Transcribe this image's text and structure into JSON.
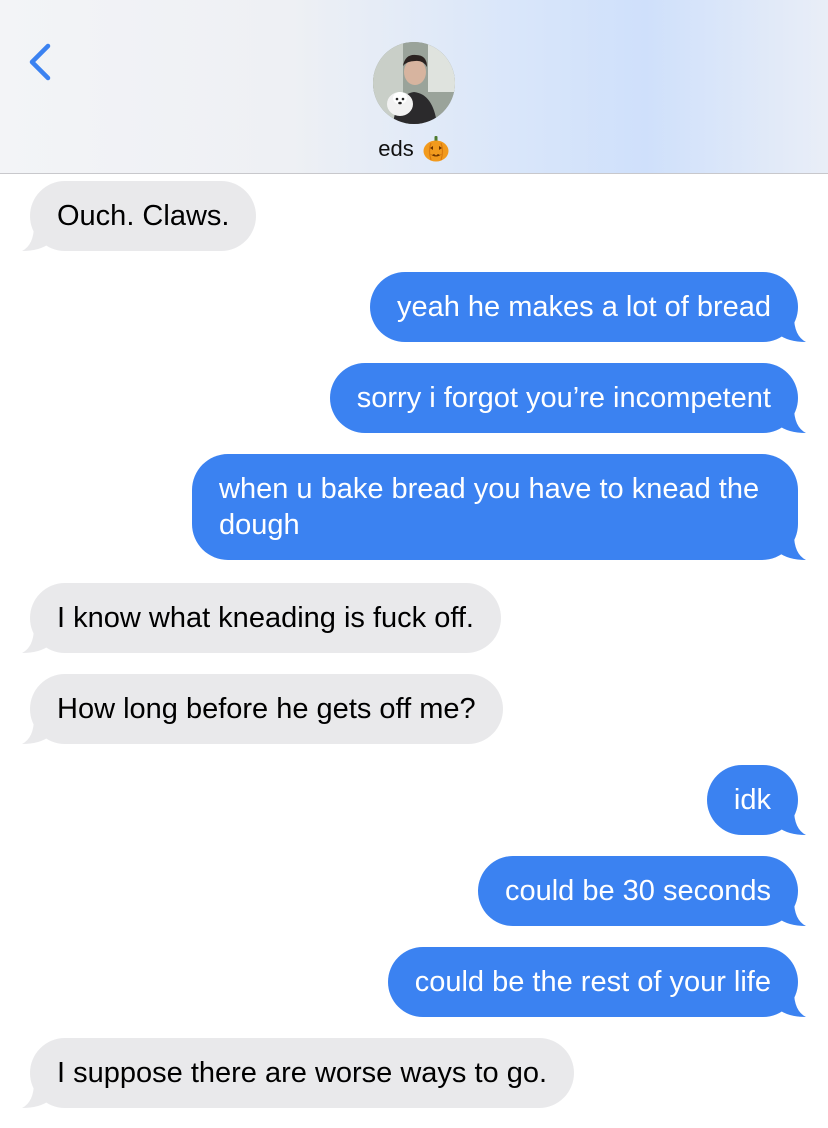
{
  "header": {
    "contact_name": "eds",
    "back_icon": "chevron-left-icon",
    "emoji_icon": "jack-o-lantern-icon",
    "accent_color": "#3b82f1"
  },
  "messages": [
    {
      "direction": "received",
      "text": "Ouch. Claws."
    },
    {
      "direction": "sent",
      "text": "yeah he makes a lot of bread"
    },
    {
      "direction": "sent",
      "text": "sorry i forgot you’re incompetent"
    },
    {
      "direction": "sent",
      "text": "when u bake bread you have to knead the dough"
    },
    {
      "direction": "received",
      "text": "I know what kneading is fuck off."
    },
    {
      "direction": "received",
      "text": "How long before he gets off me?"
    },
    {
      "direction": "sent",
      "text": "idk"
    },
    {
      "direction": "sent",
      "text": "could be 30 seconds"
    },
    {
      "direction": "sent",
      "text": "could be the rest of your life"
    },
    {
      "direction": "received",
      "text": "I suppose there are worse ways to go."
    }
  ],
  "colors": {
    "sent_bubble": "#3b82f1",
    "received_bubble": "#e9e9eb"
  }
}
